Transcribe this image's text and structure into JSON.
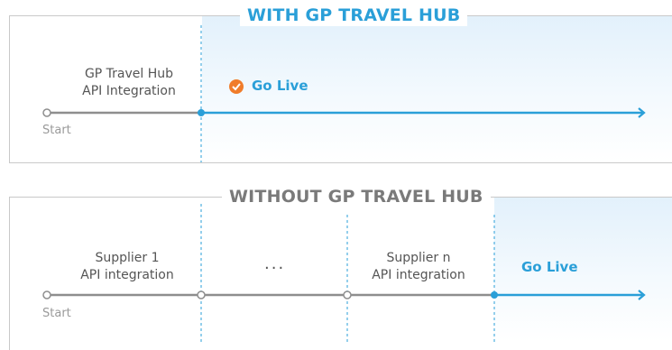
{
  "with": {
    "title": "WITH GP TRAVEL HUB",
    "step_line1": "GP Travel Hub",
    "step_line2": "API Integration",
    "go_live": "Go Live",
    "start": "Start"
  },
  "without": {
    "title": "WITHOUT GP TRAVEL HUB",
    "step1_line1": "Supplier 1",
    "step1_line2": "API integration",
    "ellipsis": "...",
    "stepn_line1": "Supplier n",
    "stepn_line2": "API integration",
    "go_live": "Go Live",
    "start": "Start"
  },
  "colors": {
    "accent_blue": "#2a9fd8",
    "accent_orange": "#f07c2a",
    "line_gray": "#8e8e8e",
    "text_gray": "#555555"
  }
}
